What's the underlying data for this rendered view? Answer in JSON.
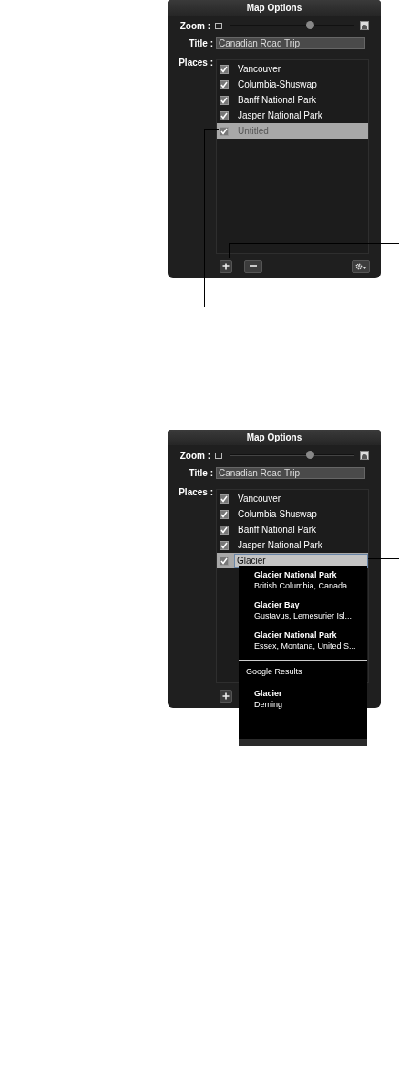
{
  "panels": [
    {
      "title": "Map Options",
      "zoom": {
        "label": "Zoom :",
        "level": 0.64
      },
      "title_field": {
        "label": "Title :",
        "value": "Canadian Road Trip"
      },
      "places": {
        "label": "Places :",
        "items": [
          {
            "name": "Vancouver",
            "checked": true,
            "selected": false,
            "editing": false
          },
          {
            "name": "Columbia-Shuswap",
            "checked": true,
            "selected": false,
            "editing": false
          },
          {
            "name": "Banff National Park",
            "checked": true,
            "selected": false,
            "editing": false
          },
          {
            "name": "Jasper National Park",
            "checked": true,
            "selected": false,
            "editing": false
          },
          {
            "name": "Untitled",
            "checked": true,
            "selected": true,
            "editing": false
          }
        ]
      },
      "buttons": [
        {
          "kind": "add"
        },
        {
          "kind": "remove"
        },
        {
          "kind": "gear"
        }
      ]
    },
    {
      "title": "Map Options",
      "zoom": {
        "label": "Zoom :",
        "level": 0.64
      },
      "title_field": {
        "label": "Title :",
        "value": "Canadian Road Trip"
      },
      "places": {
        "label": "Places :",
        "items": [
          {
            "name": "Vancouver",
            "checked": true,
            "selected": false,
            "editing": false
          },
          {
            "name": "Columbia-Shuswap",
            "checked": true,
            "selected": false,
            "editing": false
          },
          {
            "name": "Banff National Park",
            "checked": true,
            "selected": false,
            "editing": false
          },
          {
            "name": "Jasper National Park",
            "checked": true,
            "selected": false,
            "editing": false
          },
          {
            "name": "Glacier",
            "checked": true,
            "selected": true,
            "editing": true
          }
        ]
      },
      "buttons": [
        {
          "kind": "add"
        }
      ],
      "suggestions": {
        "groups": [
          {
            "items": [
              {
                "title": "Glacier National Park",
                "subtitle": "British Columbia, Canada"
              },
              {
                "title": "Glacier Bay",
                "subtitle": "Gustavus, Lemesurier Isl..."
              },
              {
                "title": "Glacier National Park",
                "subtitle": "Essex, Montana, United S..."
              }
            ]
          },
          {
            "heading": "Google Results",
            "items": [
              {
                "title": "Glacier",
                "subtitle": "Deming"
              }
            ]
          }
        ]
      }
    }
  ]
}
